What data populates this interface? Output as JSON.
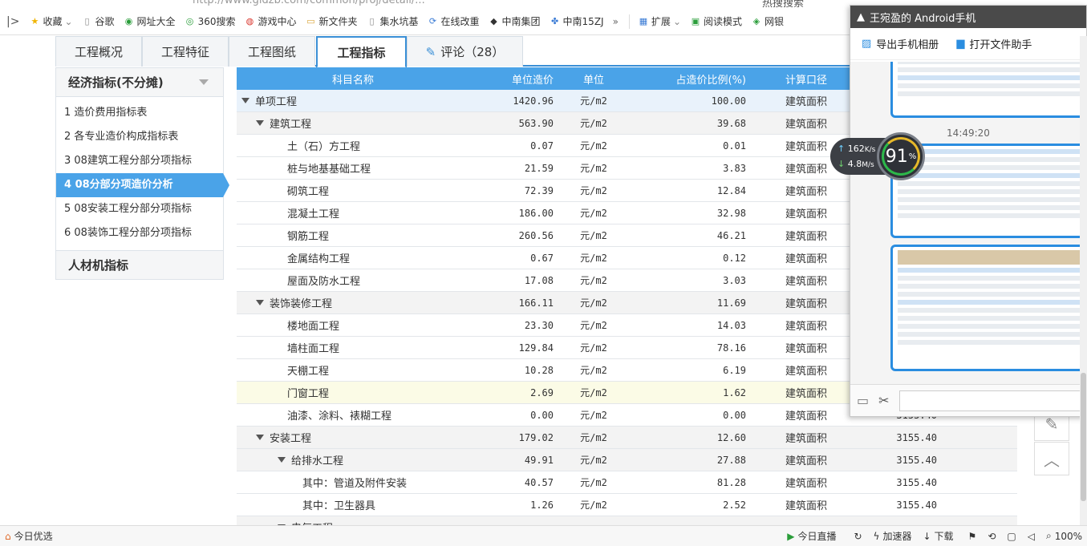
{
  "browser": {
    "url_fragment": "http://www.gldzb.com/common/proj/detail/...",
    "search_fragment": "热搜搜索",
    "bookmarks": [
      {
        "label": "收藏",
        "icon": "star-icon"
      },
      {
        "label": "谷歌",
        "icon": "page-icon"
      },
      {
        "label": "网址大全",
        "icon": "globe-icon"
      },
      {
        "label": "360搜索",
        "icon": "search-icon"
      },
      {
        "label": "游戏中心",
        "icon": "game-icon"
      },
      {
        "label": "新文件夹",
        "icon": "folder-icon"
      },
      {
        "label": "集水坑基",
        "icon": "page-icon"
      },
      {
        "label": "在线改重",
        "icon": "link-icon"
      },
      {
        "label": "中南集团",
        "icon": "abvs-icon"
      },
      {
        "label": "中南15ZJ",
        "icon": "paw-icon"
      }
    ],
    "more_label": "»",
    "extensions_label": "扩展",
    "reading_mode_label": "阅读模式",
    "netbank_label": "网银"
  },
  "tabs": [
    {
      "label": "工程概况"
    },
    {
      "label": "工程特征"
    },
    {
      "label": "工程图纸"
    },
    {
      "label": "工程指标",
      "active": true
    },
    {
      "label": "评论（28）"
    }
  ],
  "sidebar": {
    "section1_title": "经济指标(不分摊)",
    "items": [
      "1 造价费用指标表",
      "2 各专业造价构成指标表",
      "3 08建筑工程分部分项指标",
      "4 08分部分项造价分析",
      "5 08安装工程分部分项指标",
      "6 08装饰工程分部分项指标"
    ],
    "active_index": 3,
    "section2_title": "人材机指标"
  },
  "table": {
    "headers": {
      "name": "科目名称",
      "cost": "单位造价",
      "unit": "单位",
      "ratio": "占造价比例(%)",
      "basis": "计算口径",
      "area": ""
    },
    "rows": [
      {
        "name": "单项工程",
        "level": 0,
        "expand": true,
        "cost": "1420.96",
        "unit": "元/m2",
        "ratio": "100.00",
        "basis": "建筑面积",
        "area": ""
      },
      {
        "name": "建筑工程",
        "level": 1,
        "expand": true,
        "cost": "563.90",
        "unit": "元/m2",
        "ratio": "39.68",
        "basis": "建筑面积",
        "area": ""
      },
      {
        "name": "土（石）方工程",
        "level": 2,
        "cost": "0.07",
        "unit": "元/m2",
        "ratio": "0.01",
        "basis": "建筑面积",
        "area": ""
      },
      {
        "name": "桩与地基基础工程",
        "level": 2,
        "cost": "21.59",
        "unit": "元/m2",
        "ratio": "3.83",
        "basis": "建筑面积",
        "area": ""
      },
      {
        "name": "砌筑工程",
        "level": 2,
        "cost": "72.39",
        "unit": "元/m2",
        "ratio": "12.84",
        "basis": "建筑面积",
        "area": ""
      },
      {
        "name": "混凝土工程",
        "level": 2,
        "cost": "186.00",
        "unit": "元/m2",
        "ratio": "32.98",
        "basis": "建筑面积",
        "area": ""
      },
      {
        "name": "钢筋工程",
        "level": 2,
        "cost": "260.56",
        "unit": "元/m2",
        "ratio": "46.21",
        "basis": "建筑面积",
        "area": ""
      },
      {
        "name": "金属结构工程",
        "level": 2,
        "cost": "0.67",
        "unit": "元/m2",
        "ratio": "0.12",
        "basis": "建筑面积",
        "area": ""
      },
      {
        "name": "屋面及防水工程",
        "level": 2,
        "cost": "17.08",
        "unit": "元/m2",
        "ratio": "3.03",
        "basis": "建筑面积",
        "area": ""
      },
      {
        "name": "装饰装修工程",
        "level": 1,
        "expand": true,
        "cost": "166.11",
        "unit": "元/m2",
        "ratio": "11.69",
        "basis": "建筑面积",
        "area": ""
      },
      {
        "name": "楼地面工程",
        "level": 2,
        "cost": "23.30",
        "unit": "元/m2",
        "ratio": "14.03",
        "basis": "建筑面积",
        "area": ""
      },
      {
        "name": "墙柱面工程",
        "level": 2,
        "cost": "129.84",
        "unit": "元/m2",
        "ratio": "78.16",
        "basis": "建筑面积",
        "area": ""
      },
      {
        "name": "天棚工程",
        "level": 2,
        "cost": "10.28",
        "unit": "元/m2",
        "ratio": "6.19",
        "basis": "建筑面积",
        "area": ""
      },
      {
        "name": "门窗工程",
        "level": 2,
        "cost": "2.69",
        "unit": "元/m2",
        "ratio": "1.62",
        "basis": "建筑面积",
        "area": "",
        "highlight": true
      },
      {
        "name": "油漆、涂料、裱糊工程",
        "level": 2,
        "cost": "0.00",
        "unit": "元/m2",
        "ratio": "0.00",
        "basis": "建筑面积",
        "area": "3155.40"
      },
      {
        "name": "安装工程",
        "level": 1,
        "expand": true,
        "cost": "179.02",
        "unit": "元/m2",
        "ratio": "12.60",
        "basis": "建筑面积",
        "area": "3155.40"
      },
      {
        "name": "给排水工程",
        "level": 2,
        "expand": true,
        "cost": "49.91",
        "unit": "元/m2",
        "ratio": "27.88",
        "basis": "建筑面积",
        "area": "3155.40"
      },
      {
        "name": "其中：管道及附件安装",
        "level": 3,
        "cost": "40.57",
        "unit": "元/m2",
        "ratio": "81.28",
        "basis": "建筑面积",
        "area": "3155.40"
      },
      {
        "name": "其中：卫生器具",
        "level": 3,
        "cost": "1.26",
        "unit": "元/m2",
        "ratio": "2.52",
        "basis": "建筑面积",
        "area": "3155.40"
      },
      {
        "name": "电气工程",
        "level": 2,
        "expand": true,
        "cost": "",
        "unit": "",
        "ratio": "",
        "basis": "",
        "area": ""
      }
    ]
  },
  "phone_panel": {
    "title": "王宛盈的 Android手机",
    "export_label": "导出手机相册",
    "open_assistant_label": "打开文件助手",
    "time": "14:49:20"
  },
  "speed_widget": {
    "upload": "162",
    "upload_unit": "K/s",
    "download": "4.8",
    "download_unit": "M/s",
    "percent": "91",
    "percent_sign": "%"
  },
  "statusbar": {
    "left_label": "今日优选",
    "live_label": "今日直播",
    "accelerator_label": "加速器",
    "download_label": "下载",
    "zoom": "100%"
  }
}
